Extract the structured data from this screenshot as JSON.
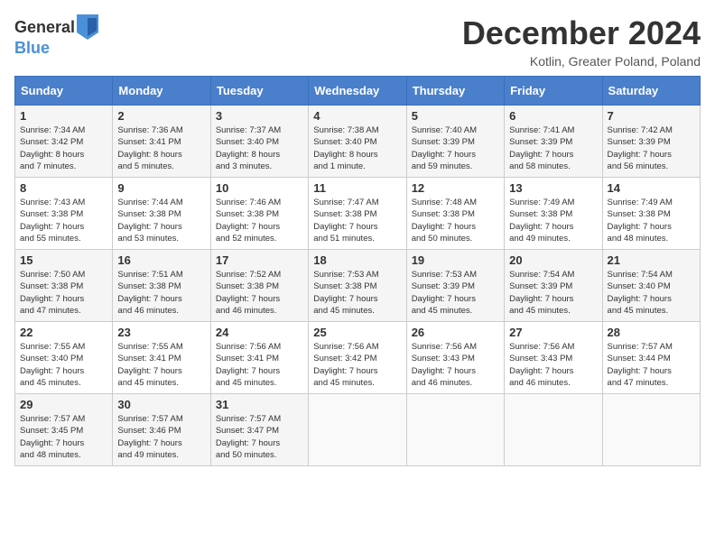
{
  "header": {
    "logo_general": "General",
    "logo_blue": "Blue",
    "month_title": "December 2024",
    "location": "Kotlin, Greater Poland, Poland"
  },
  "days_of_week": [
    "Sunday",
    "Monday",
    "Tuesday",
    "Wednesday",
    "Thursday",
    "Friday",
    "Saturday"
  ],
  "weeks": [
    [
      {
        "day": "1",
        "sunrise": "7:34 AM",
        "sunset": "3:42 PM",
        "daylight": "8 hours and 7 minutes."
      },
      {
        "day": "2",
        "sunrise": "7:36 AM",
        "sunset": "3:41 PM",
        "daylight": "8 hours and 5 minutes."
      },
      {
        "day": "3",
        "sunrise": "7:37 AM",
        "sunset": "3:40 PM",
        "daylight": "8 hours and 3 minutes."
      },
      {
        "day": "4",
        "sunrise": "7:38 AM",
        "sunset": "3:40 PM",
        "daylight": "8 hours and 1 minute."
      },
      {
        "day": "5",
        "sunrise": "7:40 AM",
        "sunset": "3:39 PM",
        "daylight": "7 hours and 59 minutes."
      },
      {
        "day": "6",
        "sunrise": "7:41 AM",
        "sunset": "3:39 PM",
        "daylight": "7 hours and 58 minutes."
      },
      {
        "day": "7",
        "sunrise": "7:42 AM",
        "sunset": "3:39 PM",
        "daylight": "7 hours and 56 minutes."
      }
    ],
    [
      {
        "day": "8",
        "sunrise": "7:43 AM",
        "sunset": "3:38 PM",
        "daylight": "7 hours and 55 minutes."
      },
      {
        "day": "9",
        "sunrise": "7:44 AM",
        "sunset": "3:38 PM",
        "daylight": "7 hours and 53 minutes."
      },
      {
        "day": "10",
        "sunrise": "7:46 AM",
        "sunset": "3:38 PM",
        "daylight": "7 hours and 52 minutes."
      },
      {
        "day": "11",
        "sunrise": "7:47 AM",
        "sunset": "3:38 PM",
        "daylight": "7 hours and 51 minutes."
      },
      {
        "day": "12",
        "sunrise": "7:48 AM",
        "sunset": "3:38 PM",
        "daylight": "7 hours and 50 minutes."
      },
      {
        "day": "13",
        "sunrise": "7:49 AM",
        "sunset": "3:38 PM",
        "daylight": "7 hours and 49 minutes."
      },
      {
        "day": "14",
        "sunrise": "7:49 AM",
        "sunset": "3:38 PM",
        "daylight": "7 hours and 48 minutes."
      }
    ],
    [
      {
        "day": "15",
        "sunrise": "7:50 AM",
        "sunset": "3:38 PM",
        "daylight": "7 hours and 47 minutes."
      },
      {
        "day": "16",
        "sunrise": "7:51 AM",
        "sunset": "3:38 PM",
        "daylight": "7 hours and 46 minutes."
      },
      {
        "day": "17",
        "sunrise": "7:52 AM",
        "sunset": "3:38 PM",
        "daylight": "7 hours and 46 minutes."
      },
      {
        "day": "18",
        "sunrise": "7:53 AM",
        "sunset": "3:38 PM",
        "daylight": "7 hours and 45 minutes."
      },
      {
        "day": "19",
        "sunrise": "7:53 AM",
        "sunset": "3:39 PM",
        "daylight": "7 hours and 45 minutes."
      },
      {
        "day": "20",
        "sunrise": "7:54 AM",
        "sunset": "3:39 PM",
        "daylight": "7 hours and 45 minutes."
      },
      {
        "day": "21",
        "sunrise": "7:54 AM",
        "sunset": "3:40 PM",
        "daylight": "7 hours and 45 minutes."
      }
    ],
    [
      {
        "day": "22",
        "sunrise": "7:55 AM",
        "sunset": "3:40 PM",
        "daylight": "7 hours and 45 minutes."
      },
      {
        "day": "23",
        "sunrise": "7:55 AM",
        "sunset": "3:41 PM",
        "daylight": "7 hours and 45 minutes."
      },
      {
        "day": "24",
        "sunrise": "7:56 AM",
        "sunset": "3:41 PM",
        "daylight": "7 hours and 45 minutes."
      },
      {
        "day": "25",
        "sunrise": "7:56 AM",
        "sunset": "3:42 PM",
        "daylight": "7 hours and 45 minutes."
      },
      {
        "day": "26",
        "sunrise": "7:56 AM",
        "sunset": "3:43 PM",
        "daylight": "7 hours and 46 minutes."
      },
      {
        "day": "27",
        "sunrise": "7:56 AM",
        "sunset": "3:43 PM",
        "daylight": "7 hours and 46 minutes."
      },
      {
        "day": "28",
        "sunrise": "7:57 AM",
        "sunset": "3:44 PM",
        "daylight": "7 hours and 47 minutes."
      }
    ],
    [
      {
        "day": "29",
        "sunrise": "7:57 AM",
        "sunset": "3:45 PM",
        "daylight": "7 hours and 48 minutes."
      },
      {
        "day": "30",
        "sunrise": "7:57 AM",
        "sunset": "3:46 PM",
        "daylight": "7 hours and 49 minutes."
      },
      {
        "day": "31",
        "sunrise": "7:57 AM",
        "sunset": "3:47 PM",
        "daylight": "7 hours and 50 minutes."
      },
      null,
      null,
      null,
      null
    ]
  ]
}
